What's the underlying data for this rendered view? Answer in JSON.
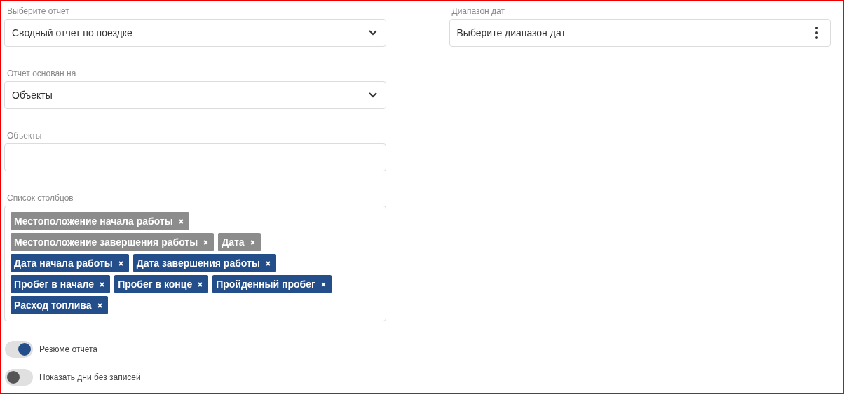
{
  "left_fields": [
    {
      "kind": "select",
      "label": "Выберите отчет",
      "value": "Сводный отчет по поездке"
    },
    {
      "kind": "select",
      "label": "Отчет основан на",
      "value": "Объекты"
    },
    {
      "kind": "text",
      "label": "Объекты"
    },
    {
      "kind": "tags",
      "label": "Список столбцов",
      "tags": [
        {
          "text": "Местоположение начала работы",
          "color": "#8c8c8c"
        },
        {
          "text": "Местоположение завершения работы",
          "color": "#8c8c8c"
        },
        {
          "text": "Дата",
          "color": "#8c8c8c"
        },
        {
          "text": "Дата начала работы",
          "color": "#234e8a"
        },
        {
          "text": "Дата завершения работы",
          "color": "#234e8a"
        },
        {
          "text": "Пробег в начале",
          "color": "#234e8a"
        },
        {
          "text": "Пробег в конце",
          "color": "#234e8a"
        },
        {
          "text": "Пройденный пробег",
          "color": "#234e8a"
        },
        {
          "text": "Расход топлива",
          "color": "#234e8a"
        }
      ]
    }
  ],
  "date_range": {
    "label": "Диапазон дат",
    "placeholder": "Выберите диапазон дат"
  },
  "toggles": [
    {
      "label": "Резюме отчета",
      "on": true
    },
    {
      "label": "Показать дни без записей",
      "on": false
    }
  ]
}
